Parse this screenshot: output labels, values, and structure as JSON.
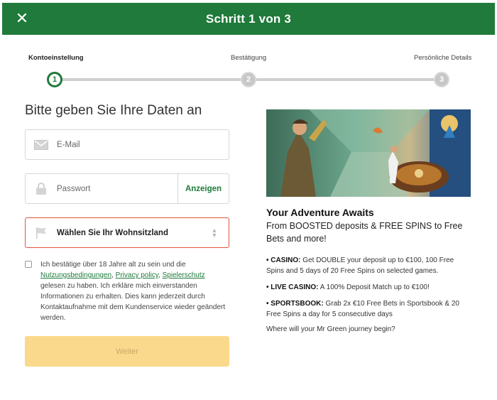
{
  "header": {
    "title": "Schritt 1 von 3",
    "close_icon": "close-icon"
  },
  "steps": {
    "items": [
      {
        "label": "Kontoeinstellung",
        "number": "1",
        "active": true
      },
      {
        "label": "Bestätigung",
        "number": "2",
        "active": false
      },
      {
        "label": "Persönliche Details",
        "number": "3",
        "active": false
      }
    ]
  },
  "form": {
    "heading": "Bitte geben Sie Ihre Daten an",
    "email_placeholder": "E-Mail",
    "password_placeholder": "Passwort",
    "show_label": "Anzeigen",
    "country_label": "Wählen Sie Ihr Wohnsitzland",
    "consent": {
      "t1": "Ich bestätige über 18 Jahre alt zu sein und die ",
      "link_terms": "Nutzungsbedingungen",
      "sep1": ", ",
      "link_privacy": "Privacy policy",
      "sep2": ", ",
      "link_protect": "Spielerschutz",
      "t2": " gelesen zu haben. Ich erkläre mich einverstanden Informationen zu erhalten. Dies kann jederzeit durch Kontaktaufnahme mit dem Kundenservice wieder geändert werden."
    },
    "submit_label": "Weiter"
  },
  "promo": {
    "title": "Your Adventure Awaits",
    "subtitle": "From BOOSTED deposits & FREE SPINS to Free Bets and more!",
    "items": [
      {
        "key": "• CASINO:",
        "text": " Get DOUBLE your deposit up to €100, 100 Free Spins and 5 days of 20 Free Spins on selected games."
      },
      {
        "key": "• LIVE CASINO:",
        "text": " A 100% Deposit Match up to €100!"
      },
      {
        "key": "• SPORTSBOOK:",
        "text": " Grab 2x €10 Free Bets in Sportsbook & 20 Free Spins a day for 5 consecutive days"
      }
    ],
    "closing": "Where will your Mr Green journey begin?"
  },
  "colors": {
    "brand": "#1f7a3b",
    "error_border": "#e0543c",
    "button_disabled": "#fbd98c"
  }
}
